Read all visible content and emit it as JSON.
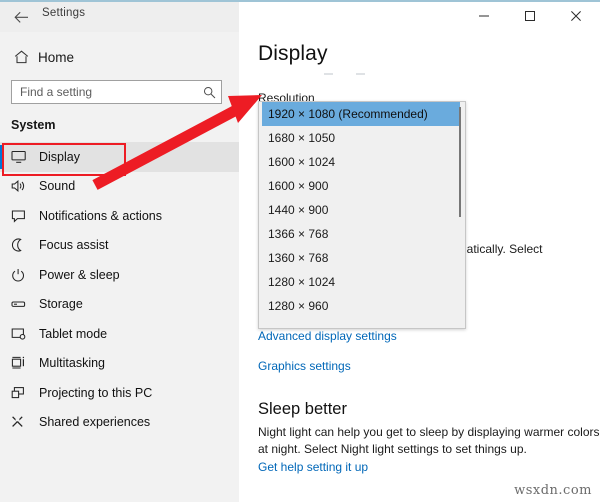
{
  "window": {
    "accent_color": "#7fb0c8",
    "title": "Settings",
    "back_icon": "back-arrow-icon",
    "controls": {
      "minimize": "–",
      "maximize": "☐",
      "close": "✕"
    }
  },
  "sidebar": {
    "home": {
      "label": "Home",
      "icon": "home-icon"
    },
    "search": {
      "placeholder": "Find a setting",
      "value": "",
      "icon": "search-icon"
    },
    "section_title": "System",
    "selected_accent": "#0078d7",
    "items": [
      {
        "label": "Display",
        "icon": "monitor-icon",
        "selected": true
      },
      {
        "label": "Sound",
        "icon": "speaker-icon",
        "selected": false
      },
      {
        "label": "Notifications & actions",
        "icon": "notification-icon",
        "selected": false
      },
      {
        "label": "Focus assist",
        "icon": "moon-icon",
        "selected": false
      },
      {
        "label": "Power & sleep",
        "icon": "power-icon",
        "selected": false
      },
      {
        "label": "Storage",
        "icon": "drive-icon",
        "selected": false
      },
      {
        "label": "Tablet mode",
        "icon": "tablet-icon",
        "selected": false
      },
      {
        "label": "Multitasking",
        "icon": "multitasking-icon",
        "selected": false
      },
      {
        "label": "Projecting to this PC",
        "icon": "project-screen-icon",
        "selected": false
      },
      {
        "label": "Shared experiences",
        "icon": "share-icon",
        "selected": false
      }
    ]
  },
  "main": {
    "page_title": "Display",
    "resolution_label": "Resolution",
    "obscured_text": "utomatically. Select",
    "links": [
      "Advanced display settings",
      "Graphics settings",
      "Get help setting it up"
    ],
    "sleep_section": {
      "heading": "Sleep better",
      "paragraph": "Night light can help you get to sleep by displaying warmer colors at night. Select Night light settings to set things up."
    },
    "watermark": "wsxdn.com"
  },
  "resolution_dropdown": {
    "open": true,
    "highlight_color": "#6aabdd",
    "options": [
      "1920 × 1080 (Recommended)",
      "1680 × 1050",
      "1600 × 1024",
      "1600 × 900",
      "1440 × 900",
      "1366 × 768",
      "1360 × 768",
      "1280 × 1024",
      "1280 × 960"
    ],
    "selected_index": 0
  },
  "annotations": {
    "arrow_color": "#ed1c24",
    "highlight_box_color": "#ed1c24"
  }
}
